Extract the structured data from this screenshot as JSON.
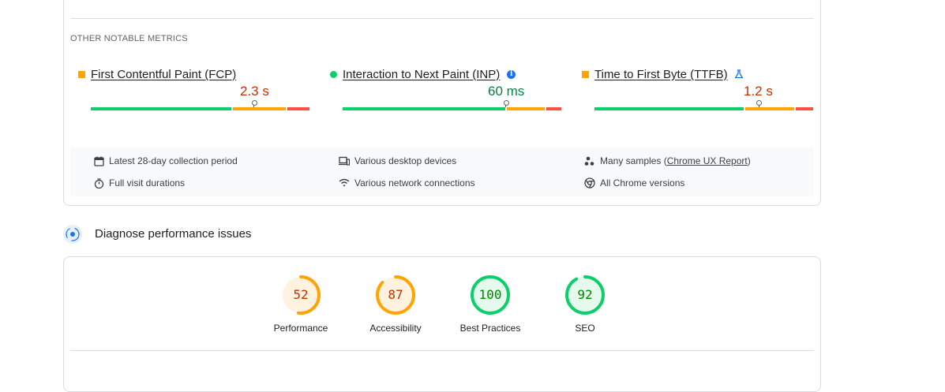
{
  "metrics_section": {
    "label": "OTHER NOTABLE METRICS",
    "metrics": [
      {
        "name": "First Contentful Paint (FCP)",
        "value": "2.3 s",
        "status": "needs-improvement",
        "status_color": "#ffa400",
        "value_color": "#c33300",
        "distribution_percent": {
          "good": 65,
          "needs_improvement": 25,
          "poor": 10
        },
        "marker_percent": 74.5
      },
      {
        "name": "Interaction to Next Paint (INP)",
        "value": "60 ms",
        "status": "good",
        "status_color": "#0cce6b",
        "value_color": "#018642",
        "distribution_percent": {
          "good": 75,
          "needs_improvement": 18,
          "poor": 7
        },
        "marker_percent": 74.5,
        "icon": "info-icon"
      },
      {
        "name": "Time to First Byte (TTFB)",
        "value": "1.2 s",
        "status": "needs-improvement",
        "status_color": "#ffa400",
        "value_color": "#c33300",
        "distribution_percent": {
          "good": 69,
          "needs_improvement": 23,
          "poor": 8
        },
        "marker_percent": 75,
        "icon": "flask-icon"
      }
    ],
    "info": {
      "collection_period": "Latest 28-day collection period",
      "visit_durations": "Full visit durations",
      "devices": "Various desktop devices",
      "network": "Various network connections",
      "samples_prefix": "Many samples (",
      "samples_link": "Chrome UX Report",
      "samples_suffix": ")",
      "chrome_versions": "All Chrome versions"
    }
  },
  "diagnose": {
    "title": "Diagnose performance issues"
  },
  "scores": [
    {
      "label": "Performance",
      "score": "52",
      "fraction": 0.52,
      "color": "#ffa400",
      "text_color": "#c33300",
      "bg": "#fff3e0"
    },
    {
      "label": "Accessibility",
      "score": "87",
      "fraction": 0.87,
      "color": "#ffa400",
      "text_color": "#c33300",
      "bg": "#fff3e0"
    },
    {
      "label": "Best Practices",
      "score": "100",
      "fraction": 1.0,
      "color": "#0cce6b",
      "text_color": "#008800",
      "bg": "#e6f9ed"
    },
    {
      "label": "SEO",
      "score": "92",
      "fraction": 0.92,
      "color": "#0cce6b",
      "text_color": "#008800",
      "bg": "#e6f9ed"
    }
  ],
  "colors": {
    "good": "#0cce6b",
    "needs_improvement": "#ffa400",
    "poor": "#ff4e42"
  }
}
